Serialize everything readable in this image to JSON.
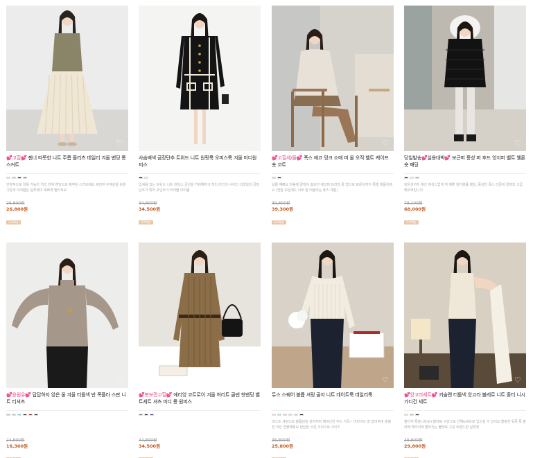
{
  "products": [
    {
      "title_prefix": "💕고힐💕",
      "title": "젠너 따뜻한 니트 주름 플리츠 데일리 겨울 밴딩 롱 스커트",
      "description": "안정적으로 착용 가능한 허리 전체 밴딩으로 제작된 스커트예요 세련미 두께감을 갖춘 기장과 아이템은 실루엣이 예쁘게 떨어져요",
      "original_price": "26,800원",
      "price": "26,800원",
      "badge": "무료배송",
      "swatches": [
        "#e8e0cf",
        "#c9c5b8",
        "#2b2b2b",
        "#8b7d6b"
      ],
      "image_theme": "beige-skirt"
    },
    {
      "title_prefix": "",
      "title": "사슴배색 금장단추 트위드 니트 원핏룩 오피스룩 겨울 미디원피스",
      "description": "입세를 있는 트위드 니트 원피스 금단을 커버해주고 허리 라인의 사이즈 디테일과 금장단추가 특히 포인트가 되어줄 아이템",
      "original_price": "34,800원",
      "price": "34,500원",
      "badge": "무료배송",
      "swatches": [
        "#1a1a1a",
        "#efe6d6"
      ],
      "image_theme": "black-tweed"
    },
    {
      "title_prefix": "💕고힐세/올💕",
      "title": "폭스 에코 밍크 소매 퍼 울 오직 벨트 케이프 숏 코트",
      "description": "실물 예뻐요 마음에 칼렉이 홍보한 에코퍼 트리밍 활 형으로 보온성까지 특별 제품이에요 (연말 모임에도 너무 잘 어울리는 퓨즈 재질)",
      "original_price": "39,800원",
      "price": "39,300원",
      "badge": "무료배송",
      "swatches": [
        "#d9c9b0",
        "#2b2b2b"
      ],
      "image_theme": "cream-cape"
    },
    {
      "title_prefix": "",
      "title": "당일발송💕실용대박💕 보근퍼 풍성 퍼 후드 엉지퍼 벨트 웰론 숏 패딩",
      "description": "보온성까지 챙긴 여성스럽게 딱 예쁜 원가볼륨 패딩, 풍성한 폭스 라쿤퍼 칼렉의 고급 에코퍼입니다",
      "original_price": "78,100원",
      "price": "68,000원",
      "badge": "무료배송",
      "swatches": [
        "#1a1a1a",
        "#efe6d6",
        "#c9a27a"
      ],
      "image_theme": "black-padding"
    },
    {
      "title_prefix": "💕응원유💕",
      "title": "답답하지 않은 울 겨울 터틀넥 반 폭플라 스판 니트 티셔츠",
      "description": "",
      "original_price": "24,800원",
      "price": "16,300원",
      "badge": "무료배송",
      "swatches": [
        "#c8b9a6",
        "#a8bfd0",
        "#7fcfcf",
        "#2b2b2b",
        "#8a2a2a",
        "#1a1a1a"
      ],
      "image_theme": "turtleneck"
    },
    {
      "title_prefix": "💕봇보깐고힐💕",
      "title": "에리엉 코트로이 겨울 허리트 골덴 핫밴딩 벨트세트 셔츠 미디 롱 원피스",
      "description": "",
      "original_price": "44,800원",
      "price": "34,500원",
      "badge": "무료배송",
      "swatches": [
        "#8a7048",
        "#1a1a1a",
        "#2a3a8a"
      ],
      "image_theme": "corduroy-dress"
    },
    {
      "title_prefix": "",
      "title": "듀스 스퀘어 볼륨 셔링 골지 니트 데이트룩 데일리룩",
      "description": "바스트 셔링으로 볼륨감을 살려주며 페미닌한 무드 가득~ 어라이드 잘 잡아주며 슬림한 라인 연출해줘요 탄탄한 사선 조직으로 사이즈",
      "original_price": "35,800원",
      "price": "25,800원",
      "badge": "무료배송",
      "swatches": [
        "#e8e0d0",
        "#bcd8e8",
        "#d8c8e8",
        "#e8d8c8",
        "#c8d8c8",
        "#1a1a1a"
      ],
      "image_theme": "square-knit"
    },
    {
      "title_prefix": "💕앙고라세트💕",
      "title": "키슬렌 터틀넥 앙고라 볼레로 니트 홀터 니시 가디건 세트",
      "description": "불터넥 특출니트로+볼레로 구성으로 인해&세트로 입으실 수 있어요 블랑한 뒷쪽 톡 볼라에 에리의에 빨리치는 볼레로 구성 트렌드한 실루엣",
      "original_price": "39,800원",
      "price": "29,800원",
      "badge": "무료배송",
      "swatches": [
        "#efe6d6",
        "#c9b9a0",
        "#2b2b2b"
      ],
      "image_theme": "angora-set"
    }
  ],
  "icons": {
    "wishlist": "heart-outline-icon"
  }
}
